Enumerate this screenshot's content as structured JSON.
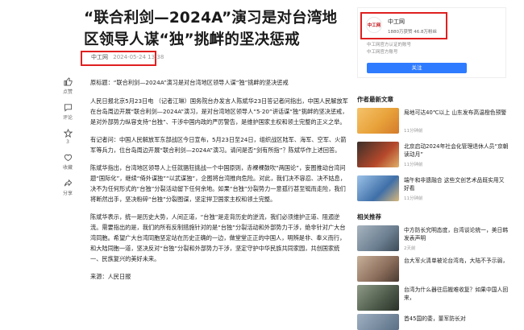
{
  "article": {
    "title": "“联合利剑—2024A”演习是对台湾地区领导人谋“独”挑衅的坚决惩戒",
    "author": "中工网",
    "date": "2024-05-24 13:38",
    "paragraphs": [
      "原标题：“联合利剑—2024A”演习是对台湾地区领导人谋“独”挑衅的坚决惩戒",
      "人民日报北京5月23日电 （记者江琳）国务院台办发言人陈斌华23日答记者问指出，中国人民解放军在台岛周边开展“联合利剑—2024A”演习，是对台湾地区领导人“5·20”讲话谋“独”挑衅的坚决惩戒，是对外部势力纵容支持“台独”、干涉中国内政的严厉警告，是维护国家主权和领土完整的正义之举。",
      "有记者问：中国人民解放军东部战区今日宣布，5月23日至24日，组织战区陆军、海军、空军、火箭军等兵力，位台岛周边开展“联合利剑—2024A”演习。请问是否“剑有所指”？陈斌华作上述回答。",
      "陈斌华指出，台湾地区领导人上任就猖狂挑战一个中国原则，赤裸裸鼓吹“两国论”，妄图推动台湾问题“国际化”，继续“倚外谋独”“以武谋独”，企图将台湾推向危险。对此，我们决不容忍、决不姑息，决不为任何形式的“台独”分裂活动留下任何余地。如果“台独”分裂势力一意孤行甚至铤而走险，我们将断然出手，坚决粉碎“台独”分裂图谋，坚定捍卫国家主权和领土完整。",
      "陈斌华表示，统一是历史大势，人间正道，“台独”是走背历史的逆流，我们必须维护正道、阻遏逆流。需要指出的是，我们的所有反制措施针对的是“台独”分裂活动和外部势力干涉，绝非针对广大台湾同胞。希望广大台湾同胞坚定站在历史正确的一边，做堂堂正正的中国人，明辨是非、奉义而行，和大陆同胞一道，坚决反对“台独”分裂和外部势力干涉，坚定守护中华民族共同家园，共创国家统一、民族复兴的美好未来。",
      "来源：人民日报"
    ]
  },
  "rail": [
    {
      "icon": "like-icon",
      "label": "点赞",
      "count": ""
    },
    {
      "icon": "comment-icon",
      "label": "评论",
      "count": ""
    },
    {
      "icon": "star-icon",
      "label": "3",
      "count": "3"
    },
    {
      "icon": "collect-icon",
      "label": "收藏",
      "count": ""
    },
    {
      "icon": "share-icon",
      "label": "分享",
      "count": ""
    }
  ],
  "author_card": {
    "avatar_text": "中工网",
    "name": "中工网",
    "stats": "1880万获赞  46.8万粉丝",
    "desc": "中工网官方认证的账号",
    "desc2": "中工网官方账号",
    "follow_label": "关注"
  },
  "sidebar": {
    "author_articles_heading": "作者最新文章",
    "author_articles": [
      {
        "title": "局地可达40℃以上 山东发布高温橙色预警",
        "time": "11分钟前",
        "color": "#e8a23a"
      },
      {
        "title": "北京启动2024年社会化管理退休人员“京朝读动月”",
        "time": "11分钟前",
        "color": "#b5482b"
      },
      {
        "title": "端午和非遗融合 这些文创艺术品既实用又好看",
        "time": "11分钟前",
        "color": "#3f6fa8"
      }
    ],
    "recommend_heading": "相关推荐",
    "recommend": [
      {
        "title": "中方防长究明态度，台湾谈论统一，美日韩发表声明",
        "time": "2天前",
        "color": "#6a7e90"
      },
      {
        "title": "台大军火清单被论台湾岛，大陆不予示弱，",
        "time": "",
        "color": "#8a6c5a"
      },
      {
        "title": "台湾为什么器往后搬难收复？如果中国人回来，",
        "time": "",
        "color": "#4d5a4a"
      },
      {
        "title": "首45国的委，董军防长对",
        "time": "",
        "color": "#5a6f85"
      }
    ]
  }
}
